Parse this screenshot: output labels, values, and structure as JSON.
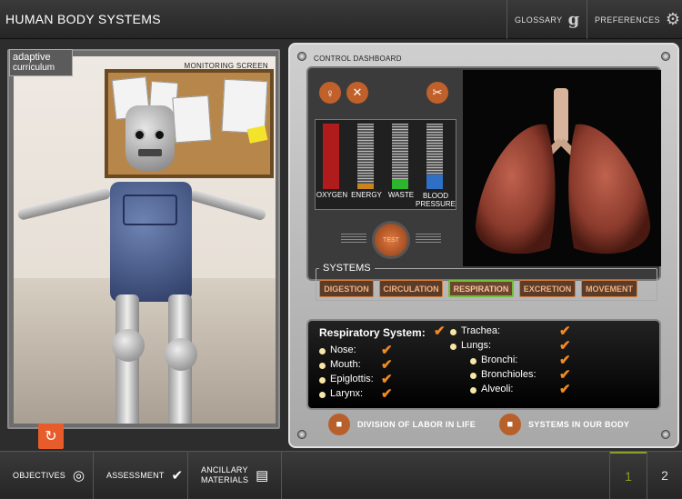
{
  "app": {
    "title": "HUMAN BODY SYSTEMS"
  },
  "header": {
    "glossary_label": "GLOSSARY",
    "glossary_icon": "g",
    "preferences_label": "PREFERENCES",
    "preferences_icon": "⚙"
  },
  "left_panel": {
    "logo_line1": "adaptive",
    "logo_line2": "curriculum",
    "monitoring_label": "MONITORING SCREEN",
    "reset_icon": "↻"
  },
  "control_dashboard": {
    "label": "CONTROL DASHBOARD",
    "meters": [
      {
        "label": "OXYGEN",
        "color": "#b01c1c",
        "level": 1.0
      },
      {
        "label": "ENERGY",
        "color": "#c9831f",
        "level": 0.08
      },
      {
        "label": "WASTE",
        "color": "#2db52d",
        "level": 0.15
      },
      {
        "label": "BLOOD PRESSURE",
        "color": "#2f6fc4",
        "level": 0.22
      }
    ],
    "test_label": "TEST",
    "systems_label": "SYSTEMS",
    "systems": [
      "DIGESTION",
      "CIRCULATION",
      "RESPIRATION",
      "EXCRETION",
      "MOVEMENT"
    ],
    "active_system": "RESPIRATION"
  },
  "respiratory": {
    "title": "Respiratory System:",
    "left_items": [
      "Nose:",
      "Mouth:",
      "Epiglottis:",
      "Larynx:"
    ],
    "right_items": [
      "Trachea:",
      "Lungs:",
      "Bronchi:",
      "Bronchioles:",
      "Alveoli:"
    ]
  },
  "links": {
    "division": "DIVISION OF LABOR IN LIFE",
    "systems": "SYSTEMS IN OUR BODY"
  },
  "footer": {
    "objectives": "OBJECTIVES",
    "assessment": "ASSESSMENT",
    "ancillary_line1": "ANCILLARY",
    "ancillary_line2": "MATERIALS",
    "page1": "1",
    "page2": "2"
  },
  "colors": {
    "accent": "#e85c2b",
    "check": "#f08a24",
    "active_border": "#6fbf3a"
  }
}
